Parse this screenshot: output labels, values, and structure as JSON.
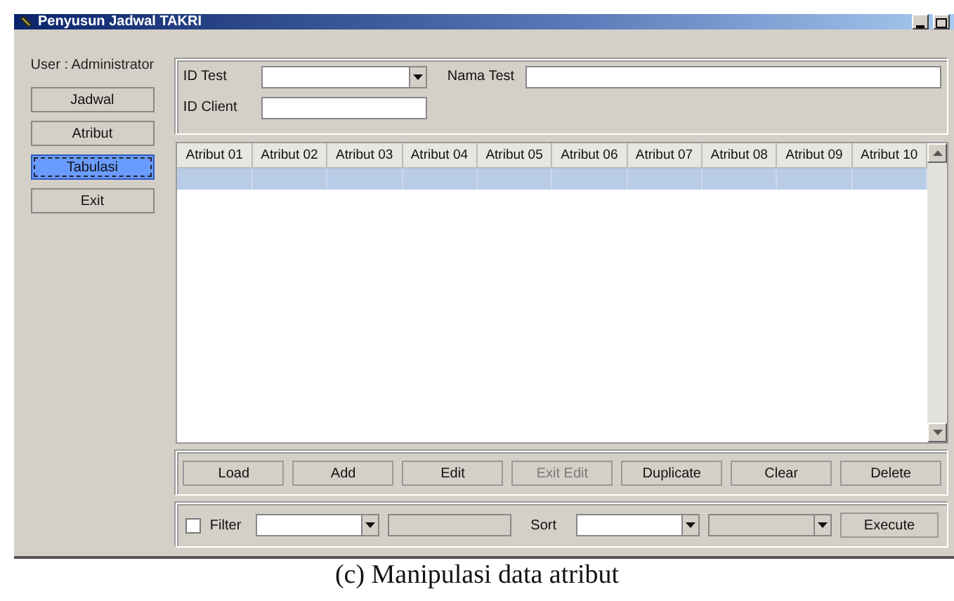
{
  "window": {
    "title": "Penyusun Jadwal TAKRI"
  },
  "sidebar": {
    "user": "User : Administrator",
    "items": [
      {
        "label": "Jadwal",
        "selected": false
      },
      {
        "label": "Atribut",
        "selected": false
      },
      {
        "label": "Tabulasi",
        "selected": true
      },
      {
        "label": "Exit",
        "selected": false
      }
    ]
  },
  "form": {
    "id_test": {
      "label": "ID Test",
      "kind": "combo"
    },
    "nama_test": {
      "label": "Nama Test",
      "kind": "text"
    },
    "id_client": {
      "label": "ID Client",
      "kind": "text"
    }
  },
  "table": {
    "columns": [
      "Atribut 01",
      "Atribut 02",
      "Atribut 03",
      "Atribut 04",
      "Atribut 05",
      "Atribut 06",
      "Atribut 07",
      "Atribut 08",
      "Atribut 09",
      "Atribut 10"
    ],
    "rows": [
      {
        "selected": true
      }
    ]
  },
  "actions": [
    {
      "label": "Load",
      "disabled": false
    },
    {
      "label": "Add",
      "disabled": false
    },
    {
      "label": "Edit",
      "disabled": false
    },
    {
      "label": "Exit Edit",
      "disabled": true
    },
    {
      "label": "Duplicate",
      "disabled": false
    },
    {
      "label": "Clear",
      "disabled": false
    },
    {
      "label": "Delete",
      "disabled": false
    }
  ],
  "filter_bar": {
    "filter": {
      "label": "Filter",
      "checked": false
    },
    "controls": [
      {
        "kind": "combo",
        "disabled": false
      },
      {
        "kind": "text",
        "disabled": true
      },
      {
        "kind": "label",
        "text": "Sort"
      },
      {
        "kind": "combo",
        "disabled": false
      },
      {
        "kind": "combo",
        "disabled": true
      }
    ],
    "execute": "Execute"
  },
  "caption": "(c) Manipulasi data atribut"
}
